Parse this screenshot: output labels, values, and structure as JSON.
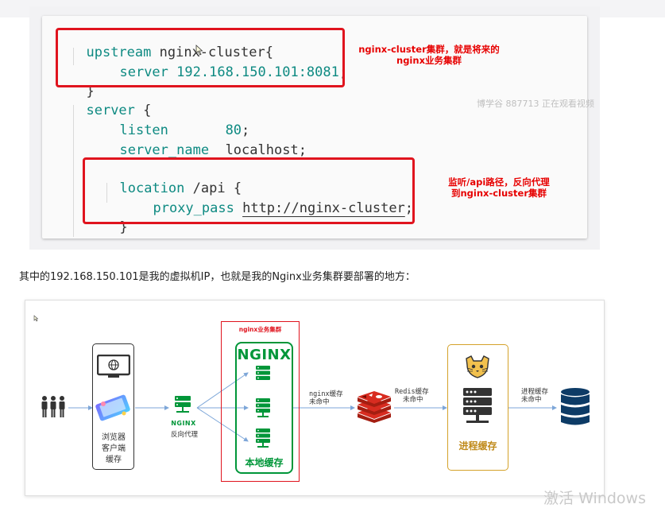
{
  "code": {
    "upstream_kw": "upstream",
    "cluster_name": "nginx-cluster",
    "open_brace": "{",
    "server_kw": "server",
    "server_ip": "192.168.150.101:8081",
    "semicolon": ";",
    "close_brace": "}",
    "server_block_kw": "server",
    "listen_kw": "listen",
    "listen_value": "80",
    "server_name_kw": "server_name",
    "server_name_value": "localhost",
    "location_kw": "location",
    "location_path": "/api",
    "proxy_pass_kw": "proxy_pass",
    "proxy_pass_value": "http://nginx-cluster"
  },
  "annotations": {
    "upstream_note_1": "nginx-cluster集群，就是将来的",
    "upstream_note_2": "nginx业务集群",
    "location_note_1": "监听/api路径，反向代理",
    "location_note_2": "到nginx-cluster集群"
  },
  "watermark": "博学谷 887713 正在观看视频",
  "caption": "其中的192.168.150.101是我的虚拟机IP，也就是我的Nginx业务集群要部署的地方：",
  "diagram": {
    "cluster_title": "nginx业务集群",
    "nginx_logo": "NGINX",
    "proxy_logo": "NGINX",
    "browser_label_1": "浏览器",
    "browser_label_2": "客户端",
    "browser_label_3": "缓存",
    "proxy_label": "反向代理",
    "local_cache": "本地缓存",
    "nginx_miss_1": "nginx缓存",
    "nginx_miss_2": "未命中",
    "redis_miss_1": "Redis缓存",
    "redis_miss_2": "未命中",
    "process_cache": "进程缓存",
    "process_miss_1": "进程缓存",
    "process_miss_2": "未命中"
  },
  "os_watermark": "激活 Windows",
  "colors": {
    "red_box": "#e0141e",
    "nginx_green": "#009639",
    "redis_red": "#d82c20",
    "tomcat_gold": "#d4a22a",
    "db_navy": "#0d3b66",
    "arrow_blue": "#7da6d8"
  }
}
